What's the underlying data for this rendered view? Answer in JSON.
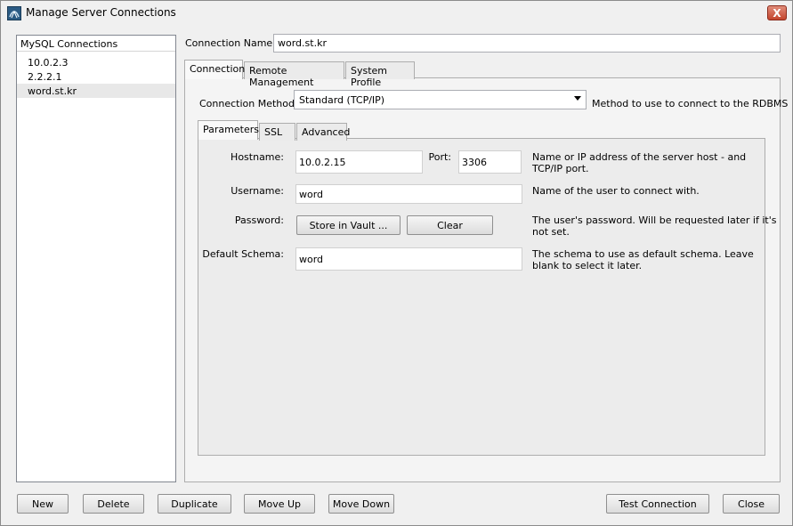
{
  "window": {
    "title": "Manage Server Connections",
    "close_label": "X"
  },
  "sidebar": {
    "header": "MySQL Connections",
    "items": [
      {
        "label": "10.0.2.3"
      },
      {
        "label": "2.2.2.1"
      },
      {
        "label": "word.st.kr"
      }
    ]
  },
  "connection_name": {
    "label": "Connection Name:",
    "value": "word.st.kr"
  },
  "tabs": [
    {
      "label": "Connection"
    },
    {
      "label": "Remote Management"
    },
    {
      "label": "System Profile"
    }
  ],
  "connection": {
    "method_label": "Connection Method:",
    "method_value": "Standard (TCP/IP)",
    "method_hint": "Method to use to connect to the RDBMS"
  },
  "subtabs": [
    {
      "label": "Parameters"
    },
    {
      "label": "SSL"
    },
    {
      "label": "Advanced"
    }
  ],
  "params": {
    "hostname_label": "Hostname:",
    "hostname_value": "10.0.2.15",
    "port_label": "Port:",
    "port_value": "3306",
    "hostname_hint_1": "Name or IP address of the server host - and",
    "hostname_hint_2": "TCP/IP port.",
    "username_label": "Username:",
    "username_value": "word",
    "username_hint": "Name of the user to connect with.",
    "password_label": "Password:",
    "store_vault": "Store in Vault ...",
    "clear": "Clear",
    "password_hint_1": "The user's password. Will be requested later if it's",
    "password_hint_2": "not set.",
    "schema_label": "Default Schema:",
    "schema_value": "word",
    "schema_hint_1": "The schema to use as default schema. Leave",
    "schema_hint_2": "blank to select it later."
  },
  "footer": {
    "new": "New",
    "delete": "Delete",
    "duplicate": "Duplicate",
    "move_up": "Move Up",
    "move_down": "Move Down",
    "test_connection": "Test Connection",
    "close": "Close"
  }
}
